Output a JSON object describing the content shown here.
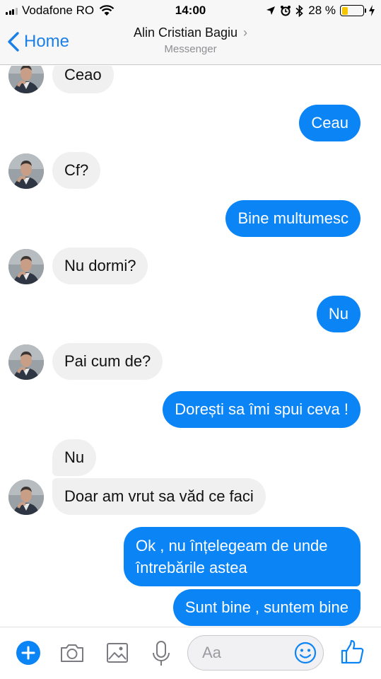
{
  "status_bar": {
    "carrier": "Vodafone RO",
    "time": "14:00",
    "battery_percent": "28 %",
    "battery_level": 0.28
  },
  "nav": {
    "back_label": "Home",
    "title": "Alin Cristian Bagiu",
    "subtitle": "Messenger"
  },
  "messages": [
    {
      "from": "them",
      "text": "Ceao"
    },
    {
      "from": "me",
      "text": "Ceau"
    },
    {
      "from": "them",
      "text": "Cf?"
    },
    {
      "from": "me",
      "text": "Bine multumesc"
    },
    {
      "from": "them",
      "text": "Nu dormi?"
    },
    {
      "from": "me",
      "text": "Nu"
    },
    {
      "from": "them",
      "text": "Pai cum de?"
    },
    {
      "from": "me",
      "text": "Dorești sa îmi spui ceva !"
    },
    {
      "from": "them",
      "text": "Nu"
    },
    {
      "from": "them",
      "text": "Doar am vrut sa văd ce faci"
    },
    {
      "from": "me",
      "text": "Ok , nu înțelegeam de unde întrebările astea"
    },
    {
      "from": "me",
      "text": "Sunt bine , suntem bine"
    }
  ],
  "composer": {
    "placeholder": "Aa",
    "icons": [
      "plus-icon",
      "camera-icon",
      "gallery-icon",
      "microphone-icon",
      "emoji-icon",
      "like-icon"
    ]
  },
  "colors": {
    "accent": "#0b84f6",
    "incoming_bubble": "#f0f0f0",
    "bar_background": "#f7f7f7",
    "battery": "#f5c500"
  }
}
